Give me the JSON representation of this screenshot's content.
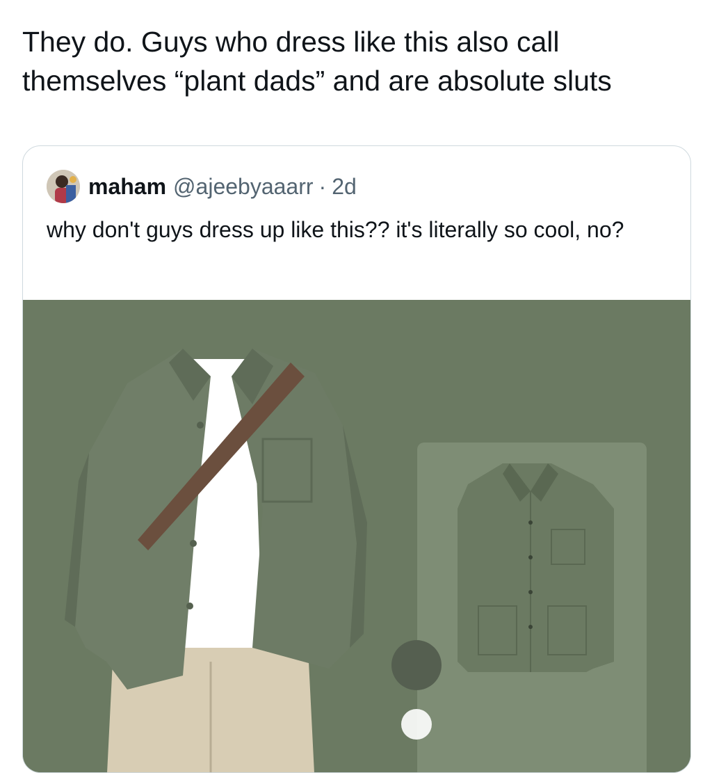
{
  "post": {
    "text": "They do. Guys who dress like this also call themselves “plant dads” and are absolute sluts"
  },
  "quoted_post": {
    "author_name": "maham",
    "handle": "@ajeebyaaarr",
    "separator": "·",
    "time": "2d",
    "text": "why don't guys dress up like this?? it's literally so cool, no?",
    "avatar_icon": "profile-photo-icon",
    "media": {
      "background_color": "#6b7a62",
      "jacket_color": "#6f7d66",
      "tshirt_color": "#ffffff",
      "pants_color": "#d8cdb4",
      "strap_color": "#6b4f3e"
    }
  }
}
